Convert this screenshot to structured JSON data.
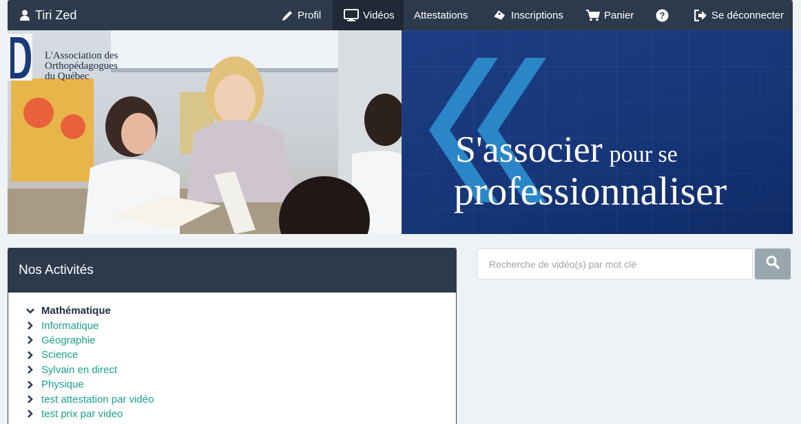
{
  "navbar": {
    "user_name": "Tiri Zed",
    "items": [
      {
        "label": "Profil",
        "icon": "pencil-icon"
      },
      {
        "label": "Vidéos",
        "icon": "monitor-icon",
        "active": true
      },
      {
        "label": "Attestations",
        "icon": ""
      },
      {
        "label": "Inscriptions",
        "icon": "ticket-icon"
      },
      {
        "label": "Panier",
        "icon": "cart-icon"
      },
      {
        "label": "",
        "icon": "help-icon"
      },
      {
        "label": "Se déconnecter",
        "icon": "logout-icon"
      }
    ]
  },
  "banner": {
    "association_name": [
      "L'Association des",
      "Orthopédagogues",
      "du Québec"
    ],
    "tagline_big": "S'associer",
    "tagline_small": "pour se",
    "tagline_line2": "professionnaliser"
  },
  "activities": {
    "title": "Nos Activités",
    "items": [
      {
        "label": "Mathématique",
        "expanded": true
      },
      {
        "label": "Informatique",
        "expanded": false
      },
      {
        "label": "Géographie",
        "expanded": false
      },
      {
        "label": "Science",
        "expanded": false
      },
      {
        "label": "Sylvain en direct",
        "expanded": false
      },
      {
        "label": "Physique",
        "expanded": false
      },
      {
        "label": "test attestation par vidéo",
        "expanded": false
      },
      {
        "label": "test prix par video",
        "expanded": false
      }
    ]
  },
  "search": {
    "placeholder": "Recherche de vidéo(s) par mot clé",
    "value": ""
  },
  "colors": {
    "navbar": "#2d3a4c",
    "link": "#1aa08a",
    "banner_blue": "#163678",
    "search_button": "#9aa6ad",
    "background": "#eff2f4"
  }
}
